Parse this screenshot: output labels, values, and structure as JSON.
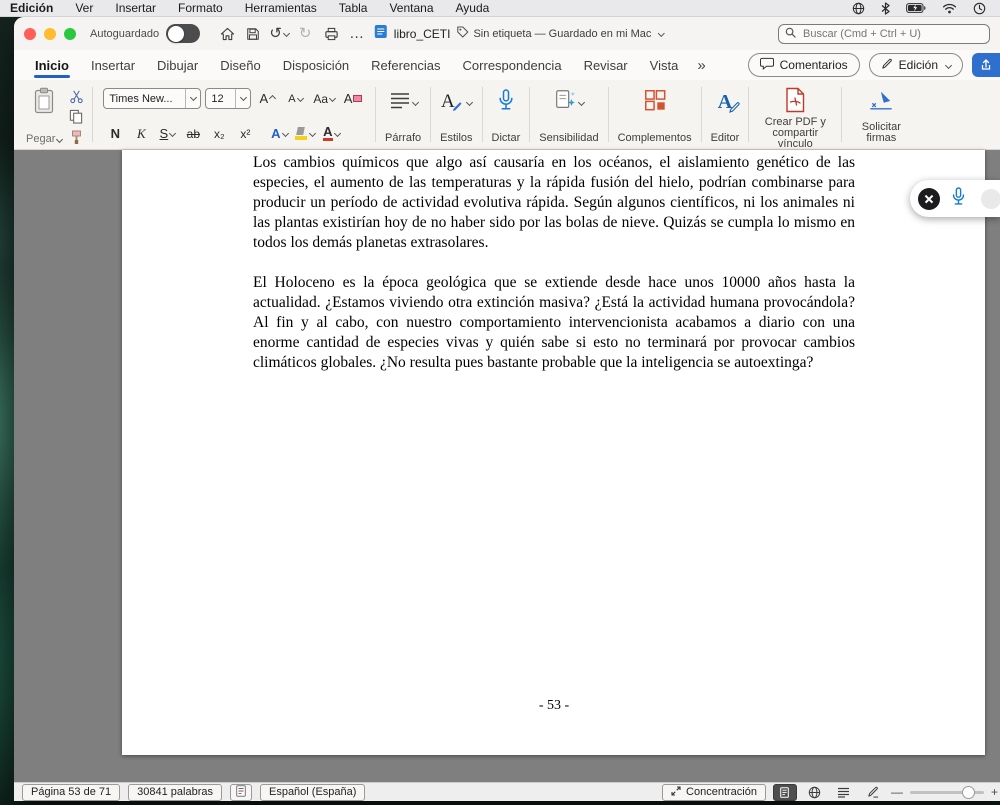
{
  "colors": {
    "accent_blue": "#2160c4",
    "tab_underline": "#2160c4",
    "mic_blue": "#1779d6",
    "pdf_red": "#c0392b",
    "addins_orange": "#d35230",
    "highlight_yellow": "#f3d11d",
    "font_color_red": "#d03a2b",
    "doc_canvas_gray": "#7f7f7f"
  },
  "menubar": {
    "items": [
      "Edición",
      "Ver",
      "Insertar",
      "Formato",
      "Herramientas",
      "Tabla",
      "Ventana",
      "Ayuda"
    ]
  },
  "titlebar": {
    "autosave": "Autoguardado",
    "doc_title": "libro_CETI",
    "doc_status": "Sin etiqueta — Guardado en mi Mac",
    "search_placeholder": "Buscar (Cmd + Ctrl + U)"
  },
  "icons": {
    "undo": "↺",
    "redo": "↻",
    "more": "…",
    "tab_overflow": "»"
  },
  "tabs": {
    "items": [
      "Inicio",
      "Insertar",
      "Dibujar",
      "Diseño",
      "Disposición",
      "Referencias",
      "Correspondencia",
      "Revisar",
      "Vista"
    ],
    "active": "Inicio",
    "comments": "Comentarios",
    "edit_button": "Edición"
  },
  "ribbon": {
    "paste": "Pegar",
    "font_name": "Times New...",
    "font_size": "12",
    "grow_font": "A",
    "shrink_font": "A",
    "case_button": "Aa",
    "clear_format": "A",
    "bold": "N",
    "italic": "K",
    "underline": "S",
    "strikethrough": "ab",
    "subscript": "x₂",
    "superscript": "x²",
    "text_effects": "A",
    "font_color": "A",
    "paragraph": "Párrafo",
    "styles": "Estilos",
    "dictate": "Dictar",
    "sensitivity": "Sensibilidad",
    "addins": "Complementos",
    "editor": "Editor",
    "create_pdf": "Crear PDF y compartir vínculo",
    "request_signatures": "Solicitar firmas"
  },
  "document": {
    "paragraphs": [
      "Los cambios químicos que algo así causaría en los océanos, el aislamiento genético de las especies, el aumento de las temperaturas y la rápida fusión del hielo, podrían combinarse para producir un período de actividad evolutiva rápida. Según algunos científicos, ni los animales ni las plantas existirían hoy de no haber sido por las bolas de nieve. Quizás se cumpla lo mismo en todos los demás planetas extrasolares.",
      "El Holoceno es la época geológica que se extiende desde hace unos 10000 años hasta la actualidad. ¿Estamos viviendo otra extinción masiva? ¿Está la actividad humana provocándola? Al fin y al cabo, con nuestro comportamiento intervencionista acabamos a diario con una enorme cantidad de especies vivas y quién sabe si esto no terminará por provocar cambios climáticos globales. ¿No resulta pues bastante probable que la inteligencia se autoextinga?"
    ],
    "page_number": "- 53 -"
  },
  "statusbar": {
    "page": "Página 53 de 71",
    "words": "30841 palabras",
    "language": "Español (España)",
    "focus": "Concentración"
  }
}
